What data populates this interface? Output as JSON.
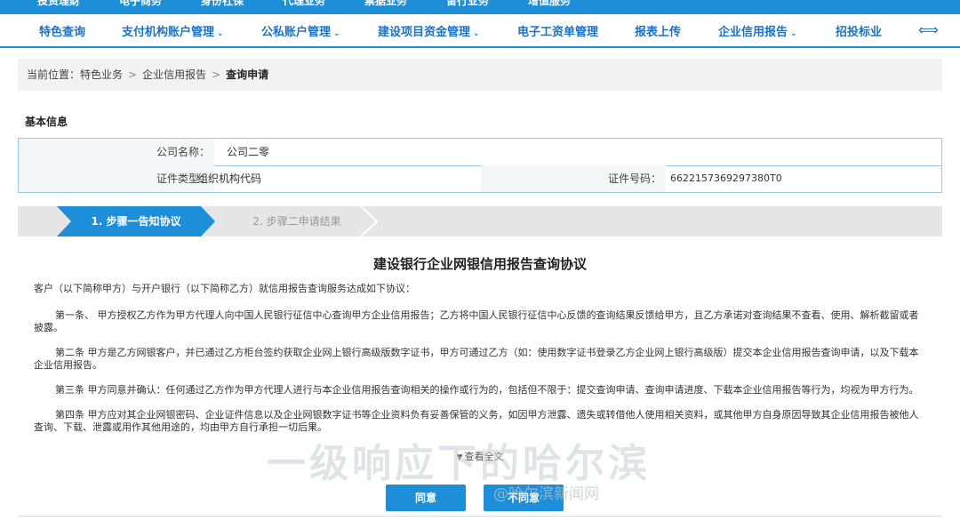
{
  "top_nav": {
    "items": [
      "投资理财",
      "电子商务",
      "身份社保",
      "代理业务",
      "票据业务",
      "留行业务",
      "增值服务"
    ]
  },
  "main_nav": {
    "items": [
      {
        "label": "特色查询",
        "dropdown": false
      },
      {
        "label": "支付机构账户管理",
        "dropdown": true
      },
      {
        "label": "公私账户管理",
        "dropdown": true
      },
      {
        "label": "建设项目资金管理",
        "dropdown": true
      },
      {
        "label": "电子工资单管理",
        "dropdown": false
      },
      {
        "label": "报表上传",
        "dropdown": false
      },
      {
        "label": "企业信用报告",
        "dropdown": true
      },
      {
        "label": "招投标业",
        "dropdown": false
      }
    ],
    "chevron": "⌄",
    "scroll_icon": "⟺"
  },
  "breadcrumb": {
    "prefix": "当前位置：",
    "items": [
      "特色业务",
      "企业信用报告"
    ],
    "current": "查询申请",
    "separator": ">"
  },
  "basic_info": {
    "title": "基本信息",
    "company_label": "公司名称：",
    "company_value": "公司二零",
    "id_type_label": "证件类型：",
    "id_type_value": "组织机构代码",
    "id_no_label": "证件号码：",
    "id_no_value": "6622157369297380T0"
  },
  "steps": [
    {
      "label": "1. 步骤一告知协议",
      "active": true
    },
    {
      "label": "2. 步骤二申请结果",
      "active": false
    }
  ],
  "agreement": {
    "title": "建设银行企业网银信用报告查询协议",
    "intro": "客户（以下简称甲方）与开户银行（以下简称乙方）就信用报告查询服务达成如下协议：",
    "clauses": [
      "第一条、 甲方授权乙方作为甲方代理人向中国人民银行征信中心查询甲方企业信用报告；乙方将中国人民银行征信中心反馈的查询结果反馈给甲方，且乙方承诺对查询结果不查看、使用、解析截留或者披露。",
      "第二条 甲方是乙方网银客户，并已通过乙方柜台签约获取企业网上银行高级版数字证书，甲方可通过乙方（如：使用数字证书登录乙方企业网上银行高级版）提交本企业信用报告查询申请，以及下载本企业信用报告。",
      "第三条 甲方同意并确认：任何通过乙方作为甲方代理人进行与本企业信用报告查询相关的操作或行为的，包括但不限于：提交查询申请、查询申请进度、下载本企业信用报告等行为，均视为甲方行为。",
      "第四条 甲方应对其企业网银密码、企业证件信息以及企业网银数字证书等企业资料负有妥善保管的义务，如因甲方泄露、遗失或转借他人使用相关资料，或其他甲方自身原因导致其企业信用报告被他人查询、下载、泄露或用作其他用途的，均由甲方自行承担一切后果。"
    ],
    "view_all": "查看全文",
    "view_all_icon": "▼"
  },
  "buttons": {
    "agree": "同意",
    "disagree": "不同意"
  },
  "watermark": {
    "text": "一级响应下的哈尔滨",
    "source": "@哈尔滨新闻网"
  },
  "colors": {
    "primary": "#1d8fd8",
    "nav_text": "#1a73c8",
    "step_inactive_bg": "#e6e6e6",
    "info_border": "#9cc7e8"
  }
}
